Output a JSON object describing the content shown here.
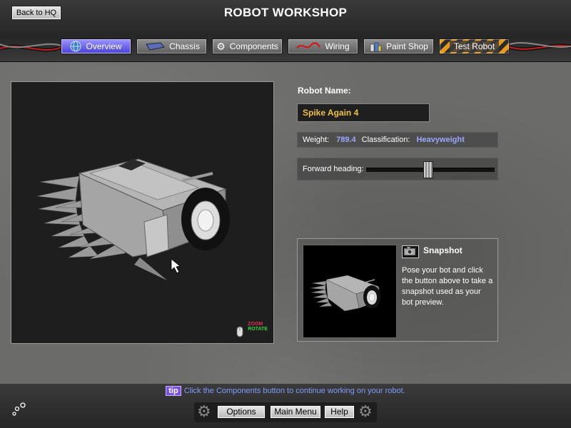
{
  "header": {
    "title": "ROBOT WORKSHOP",
    "back_label": "Back to HQ"
  },
  "tabs": [
    {
      "label": "Overview",
      "icon": "globe-icon",
      "active": true
    },
    {
      "label": "Chassis",
      "icon": "chassis-icon",
      "active": false
    },
    {
      "label": "Components",
      "icon": "gear-icon",
      "active": false
    },
    {
      "label": "Wiring",
      "icon": "wire-icon",
      "active": false
    },
    {
      "label": "Paint Shop",
      "icon": "paint-cans-icon",
      "active": false
    },
    {
      "label": "Test Robot",
      "icon": "hazard-stripes",
      "active": false
    }
  ],
  "viewport": {
    "zoom_label": "ZOOM",
    "rotate_label": "ROTATE"
  },
  "robot": {
    "name_label": "Robot Name:",
    "name_value": "Spike Again 4",
    "weight_label": "Weight:",
    "weight_value": "789.4",
    "class_label": "Classification:",
    "class_value": "Heavyweight",
    "heading_label": "Forward heading:",
    "heading_fraction": 0.48
  },
  "snapshot": {
    "title": "Snapshot",
    "description": "Pose your bot and click the button above to take a snapshot used as your bot preview."
  },
  "footer": {
    "tip_badge": "tip",
    "tip_text": "Click the Components button to continue working on your robot.",
    "options_label": "Options",
    "main_menu_label": "Main Menu",
    "help_label": "Help"
  },
  "colors": {
    "accent_active": "#4a3fd8",
    "name_text": "#f0c040",
    "value_text": "#9aa8ff",
    "tip_text": "#7f9cff",
    "zoom_color": "#e0305a",
    "rotate_color": "#3ad13a"
  }
}
